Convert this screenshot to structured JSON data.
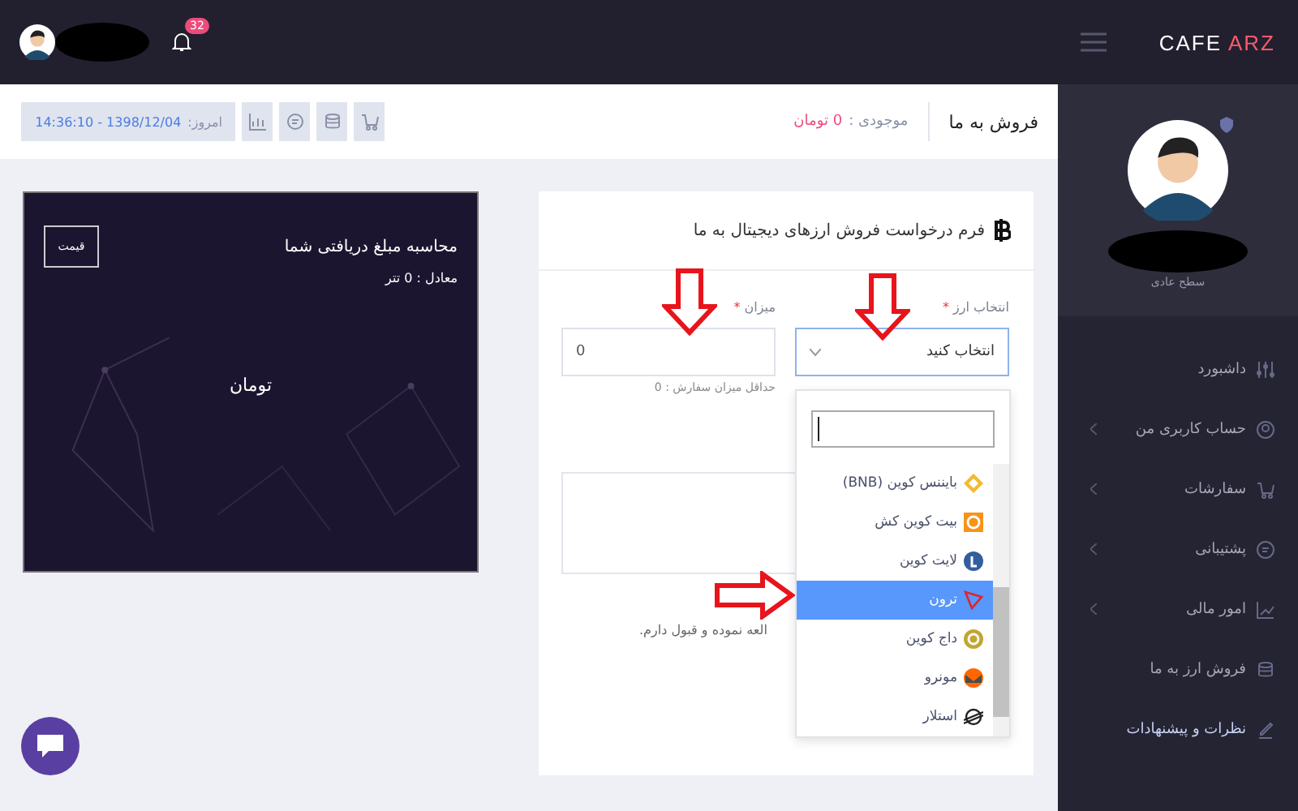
{
  "brand": {
    "first": "CAFE",
    "second": "ARZ"
  },
  "topbar": {
    "notifications": "32"
  },
  "page_header": {
    "title": "فروش به ما",
    "balance_label": "موجودی :",
    "balance_value": "0 تومان",
    "date_label": "امروز:",
    "date_value": "1398/12/04 - 14:36:10"
  },
  "profile": {
    "level": "سطح عادی"
  },
  "sidebar": {
    "items": [
      {
        "label": "داشبورد",
        "has_submenu": false,
        "selected": false
      },
      {
        "label": "حساب کاربری من",
        "has_submenu": true,
        "selected": false
      },
      {
        "label": "سفارشات",
        "has_submenu": true,
        "selected": false
      },
      {
        "label": "پشتیبانی",
        "has_submenu": true,
        "selected": false
      },
      {
        "label": "امور مالی",
        "has_submenu": true,
        "selected": false
      },
      {
        "label": "فروش ارز به ما",
        "has_submenu": false,
        "selected": false
      },
      {
        "label": "نظرات و پیشنهادات",
        "has_submenu": false,
        "selected": true
      }
    ]
  },
  "calculator": {
    "title": "محاسبه مبلغ دریافتی شما",
    "button": "قیمت",
    "equivalent": "معادل : 0 تتر",
    "total": "تومان"
  },
  "form": {
    "title": "فرم درخواست فروش ارزهای دیجیتال به ما",
    "currency": {
      "label": "انتخاب ارز",
      "required_mark": "*",
      "value": "انتخاب کنید"
    },
    "amount": {
      "label": "میزان",
      "required_mark": "*",
      "value": "0",
      "hint": "حداقل میزان سفارش : 0"
    },
    "agreement": "العه نموده و قبول دارم."
  },
  "dropdown": {
    "options": [
      {
        "label": "(BNB) بایننس کوین",
        "selected": false
      },
      {
        "label": "بیت کوین کش",
        "selected": false
      },
      {
        "label": "لایت کوین",
        "selected": false
      },
      {
        "label": "ترون",
        "selected": true
      },
      {
        "label": "داج کوین",
        "selected": false
      },
      {
        "label": "مونرو",
        "selected": false
      },
      {
        "label": "استلار",
        "selected": false
      }
    ]
  }
}
